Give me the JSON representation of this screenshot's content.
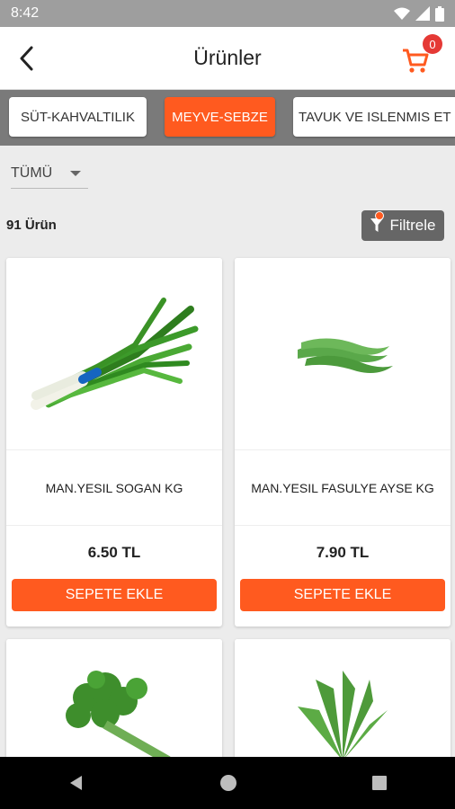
{
  "status": {
    "time": "8:42"
  },
  "app_bar": {
    "title": "Ürünler",
    "cart_count": "0"
  },
  "categories": [
    {
      "label": "SÜT-KAHVALTILIK"
    },
    {
      "label": "MEYVE-SEBZE"
    },
    {
      "label": "TAVUK VE ISLENMIS ET"
    }
  ],
  "filters": {
    "dropdown_value": "TÜMÜ",
    "product_count": "91 Ürün",
    "filter_label": "Filtrele"
  },
  "products": [
    {
      "name": "MAN.YESIL SOGAN KG",
      "price": "6.50 TL",
      "button": "SEPETE EKLE"
    },
    {
      "name": "MAN.YESIL FASULYE AYSE KG",
      "price": "7.90 TL",
      "button": "SEPETE EKLE"
    }
  ],
  "colors": {
    "accent": "#ff5a1f",
    "badge": "#e53935"
  }
}
